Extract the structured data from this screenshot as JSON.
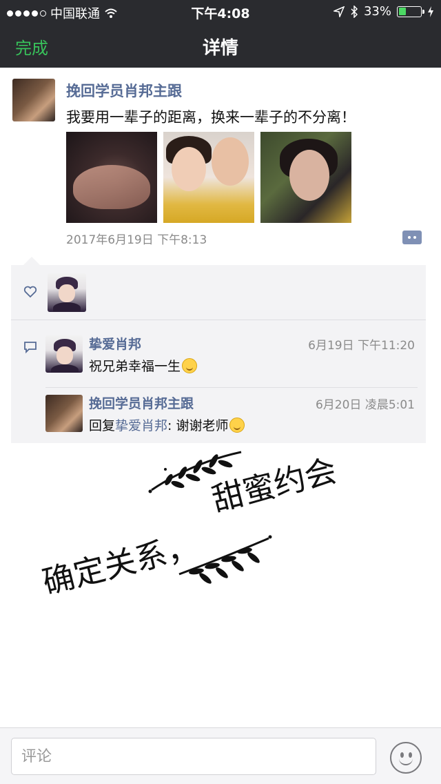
{
  "status_bar": {
    "carrier": "中国联通",
    "time": "下午4:08",
    "battery_text": "33%",
    "battery_level": 0.33
  },
  "nav": {
    "done_label": "完成",
    "title": "详情"
  },
  "post": {
    "author": "挽回学员肖邦主跟",
    "text": "我要用一辈子的距离，换来一辈子的不分离！",
    "timestamp": "2017年6月19日 下午8:13",
    "photo_count": 3
  },
  "comments": [
    {
      "author": "挚爱肖邦",
      "time": "6月19日 下午11:20",
      "text": "祝兄弟幸福一生"
    },
    {
      "author": "挽回学员肖邦主跟",
      "time": "6月20日 凌晨5:01",
      "reply_prefix": "回复",
      "reply_to": "挚爱肖邦",
      "text": ": 谢谢老师"
    }
  ],
  "artwork": {
    "line1": "甜蜜约会",
    "line2": "确定关系，"
  },
  "input": {
    "placeholder": "评论"
  },
  "colors": {
    "nav_bg": "#2a2b2f",
    "accent_green": "#38c35b",
    "name_blue": "#566b95"
  }
}
